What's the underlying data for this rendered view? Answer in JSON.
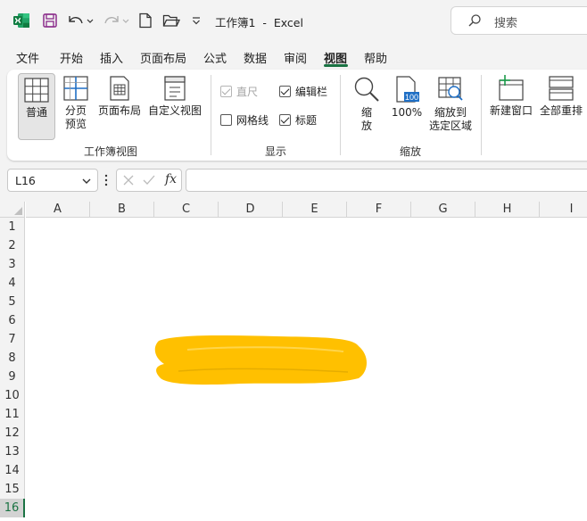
{
  "titlebar": {
    "title": "工作簿1  -  Excel",
    "search_placeholder": "搜索",
    "brand_color": "#1a7343"
  },
  "menu": {
    "tabs": [
      {
        "label": "文件"
      },
      {
        "label": "开始"
      },
      {
        "label": "插入"
      },
      {
        "label": "页面布局"
      },
      {
        "label": "公式"
      },
      {
        "label": "数据"
      },
      {
        "label": "审阅"
      },
      {
        "label": "视图",
        "active": true
      },
      {
        "label": "帮助"
      }
    ]
  },
  "ribbon": {
    "workbook_views": {
      "label": "工作簿视图",
      "normal": "普通",
      "page_break_line1": "分页",
      "page_break_line2": "预览",
      "page_layout": "页面布局",
      "custom_views": "自定义视图"
    },
    "show": {
      "label": "显示",
      "ruler": {
        "label": "直尺",
        "checked": true,
        "disabled": true
      },
      "formula_bar": {
        "label": "编辑栏",
        "checked": true
      },
      "gridlines": {
        "label": "网格线",
        "checked": false
      },
      "headings": {
        "label": "标题",
        "checked": true
      }
    },
    "zoom": {
      "label": "缩放",
      "zoom_line1": "缩",
      "zoom_line2": "放",
      "hundred": "100%",
      "hundred_icon_text": "100",
      "zoom_selection_line1": "缩放到",
      "zoom_selection_line2": "选定区域"
    },
    "window": {
      "new_window": "新建窗口",
      "arrange_all": "全部重排"
    }
  },
  "formula_bar": {
    "name_box": "L16",
    "fx": "fx",
    "content": ""
  },
  "grid": {
    "columns": [
      "A",
      "B",
      "C",
      "D",
      "E",
      "F",
      "G",
      "H",
      "I"
    ],
    "rows": [
      "1",
      "2",
      "3",
      "4",
      "5",
      "6",
      "7",
      "8",
      "9",
      "10",
      "11",
      "12",
      "13",
      "14",
      "15",
      "16"
    ],
    "selected_row": "16",
    "redaction_color": "#ffc000"
  }
}
